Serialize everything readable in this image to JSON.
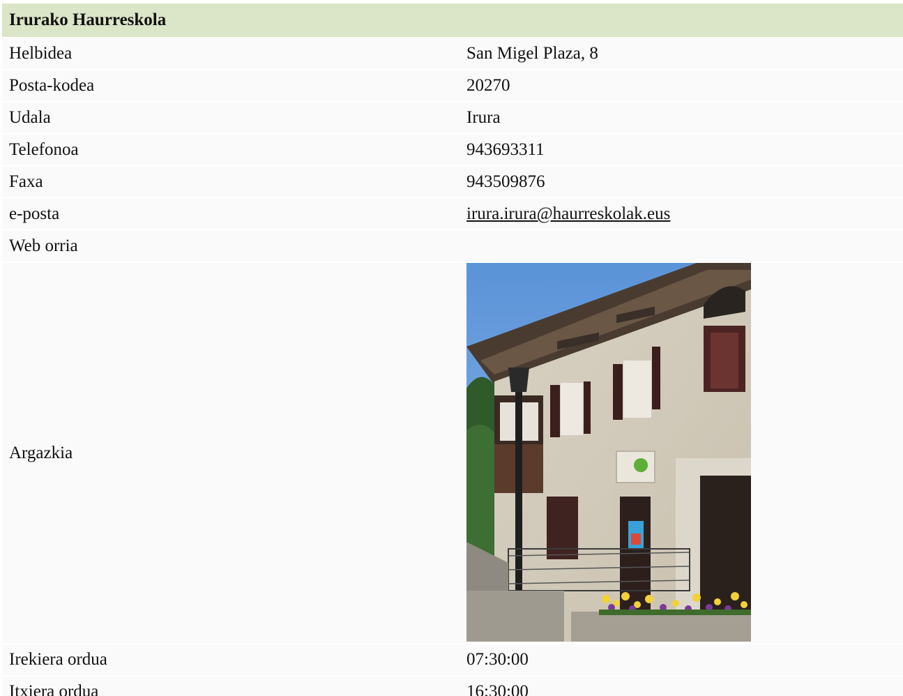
{
  "title": "Irurako Haurreskola",
  "rows": [
    {
      "label": "Helbidea",
      "value": "San Migel Plaza, 8"
    },
    {
      "label": "Posta-kodea",
      "value": "20270"
    },
    {
      "label": "Udala",
      "value": "Irura"
    },
    {
      "label": "Telefonoa",
      "value": "943693311"
    },
    {
      "label": "Faxa",
      "value": "943509876"
    },
    {
      "label": "e-posta",
      "value": "irura.irura@haurreskolak.eus"
    },
    {
      "label": "Web orria",
      "value": ""
    }
  ],
  "photo": {
    "label": "Argazkia"
  },
  "hours": [
    {
      "label": "Irekiera ordua",
      "value": "07:30:00"
    },
    {
      "label": "Itxiera ordua",
      "value": "16:30:00"
    }
  ],
  "colors": {
    "header_bg": "#dbe5c7"
  }
}
